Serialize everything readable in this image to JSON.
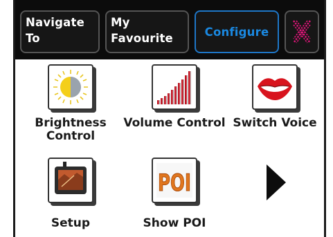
{
  "tabs": {
    "navigate_label": "Navigate To",
    "favourite_label": "My Favourite",
    "configure_label": "Configure",
    "close_icon": "close-icon"
  },
  "tiles": [
    {
      "label": "Brightness Control",
      "icon": "brightness-icon"
    },
    {
      "label": "Volume Control",
      "icon": "volume-icon"
    },
    {
      "label": "Switch Voice",
      "icon": "lips-icon"
    },
    {
      "label": "Setup",
      "icon": "device-setup-icon"
    },
    {
      "label": "Show POI",
      "icon": "poi-icon",
      "icon_text": "POI"
    },
    {
      "label": "",
      "icon": "next-page-arrow-icon"
    }
  ],
  "colors": {
    "tabbar_background": "#0c0c0c",
    "active_tab_border": "#1e77c8",
    "active_tab_text": "#1a88e0",
    "close_icon": "#e0157a",
    "poi_orange": "#e0761e"
  }
}
